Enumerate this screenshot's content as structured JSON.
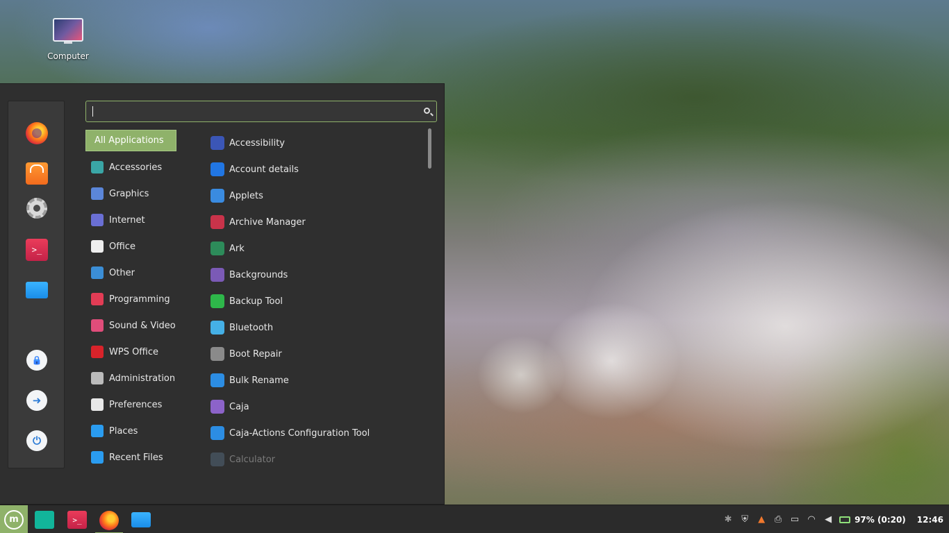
{
  "desktop": {
    "icons": [
      {
        "label": "Computer",
        "icon": "computer-icon"
      }
    ]
  },
  "menu": {
    "search": {
      "value": "",
      "placeholder": ""
    },
    "favorites": [
      {
        "name": "firefox",
        "icon": "firefox-icon"
      },
      {
        "name": "software-manager",
        "icon": "shopping-bag-icon"
      },
      {
        "name": "system-settings",
        "icon": "gear-icon"
      },
      {
        "name": "terminal",
        "icon": "terminal-icon",
        "glyph": ">_"
      },
      {
        "name": "files",
        "icon": "folder-icon"
      }
    ],
    "session": [
      {
        "name": "lock-screen",
        "icon": "lock-icon",
        "glyph": "🔒"
      },
      {
        "name": "logout",
        "icon": "logout-icon",
        "glyph": "➜"
      },
      {
        "name": "quit",
        "icon": "power-icon",
        "glyph": "⏻"
      }
    ],
    "categories": [
      {
        "label": "All Applications",
        "active": true,
        "color": "#8fb26a"
      },
      {
        "label": "Accessories",
        "color": "#3aa6a6"
      },
      {
        "label": "Graphics",
        "color": "#5b86d9"
      },
      {
        "label": "Internet",
        "color": "#6a6fd4"
      },
      {
        "label": "Office",
        "color": "#eeeeee"
      },
      {
        "label": "Other",
        "color": "#3b8ed6"
      },
      {
        "label": "Programming",
        "color": "#e23c55"
      },
      {
        "label": "Sound & Video",
        "color": "#e04d7a"
      },
      {
        "label": "WPS Office",
        "color": "#d8232a"
      },
      {
        "label": "Administration",
        "color": "#bbbbbb"
      },
      {
        "label": "Preferences",
        "color": "#e8e8e8"
      },
      {
        "label": "Places",
        "color": "#2a9cf0"
      },
      {
        "label": "Recent Files",
        "color": "#2a9cf0"
      }
    ],
    "applications": [
      {
        "label": "Accessibility",
        "color": "#3b56b6"
      },
      {
        "label": "Account details",
        "color": "#2176e3"
      },
      {
        "label": "Applets",
        "color": "#3a8be0"
      },
      {
        "label": "Archive Manager",
        "color": "#c9334a"
      },
      {
        "label": "Ark",
        "color": "#2d8b5a"
      },
      {
        "label": "Backgrounds",
        "color": "#7b5ab6"
      },
      {
        "label": "Backup Tool",
        "color": "#2eb74a"
      },
      {
        "label": "Bluetooth",
        "color": "#45b0e6"
      },
      {
        "label": "Boot Repair",
        "color": "#8a8a8a"
      },
      {
        "label": "Bulk Rename",
        "color": "#2c8de3"
      },
      {
        "label": "Caja",
        "color": "#8c63c9"
      },
      {
        "label": "Caja-Actions Configuration Tool",
        "color": "#2c8de3"
      },
      {
        "label": "Calculator",
        "color": "#556b80",
        "dim": true
      }
    ]
  },
  "taskbar": {
    "menu_button": {
      "glyph": "m",
      "color": "#8fb26a"
    },
    "apps": [
      {
        "name": "xed-text-editor",
        "icon": "text-editor-icon",
        "color": "#12b59a"
      },
      {
        "name": "terminal",
        "icon": "terminal-icon",
        "color": "#e23c55",
        "glyph": ">_"
      },
      {
        "name": "firefox",
        "icon": "firefox-icon",
        "color": "#ff7a1a",
        "active": true
      },
      {
        "name": "files",
        "icon": "folder-icon",
        "color": "#2a9cf0"
      }
    ],
    "tray": {
      "icons": [
        {
          "name": "bluetooth",
          "icon": "bluetooth-icon",
          "glyph": "✱"
        },
        {
          "name": "security",
          "icon": "shield-icon",
          "glyph": "⛨"
        },
        {
          "name": "update-warning",
          "icon": "warning-icon",
          "glyph": "▲",
          "color": "#f0782d"
        },
        {
          "name": "printer",
          "icon": "printer-icon",
          "glyph": "⎙"
        },
        {
          "name": "notes",
          "icon": "notes-icon",
          "glyph": "▭"
        },
        {
          "name": "network",
          "icon": "wifi-icon",
          "glyph": "◠"
        },
        {
          "name": "volume",
          "icon": "volume-icon",
          "glyph": "◀"
        }
      ],
      "battery": {
        "icon": "battery-icon",
        "text": "97% (0:20)"
      },
      "clock": "12:46"
    }
  }
}
